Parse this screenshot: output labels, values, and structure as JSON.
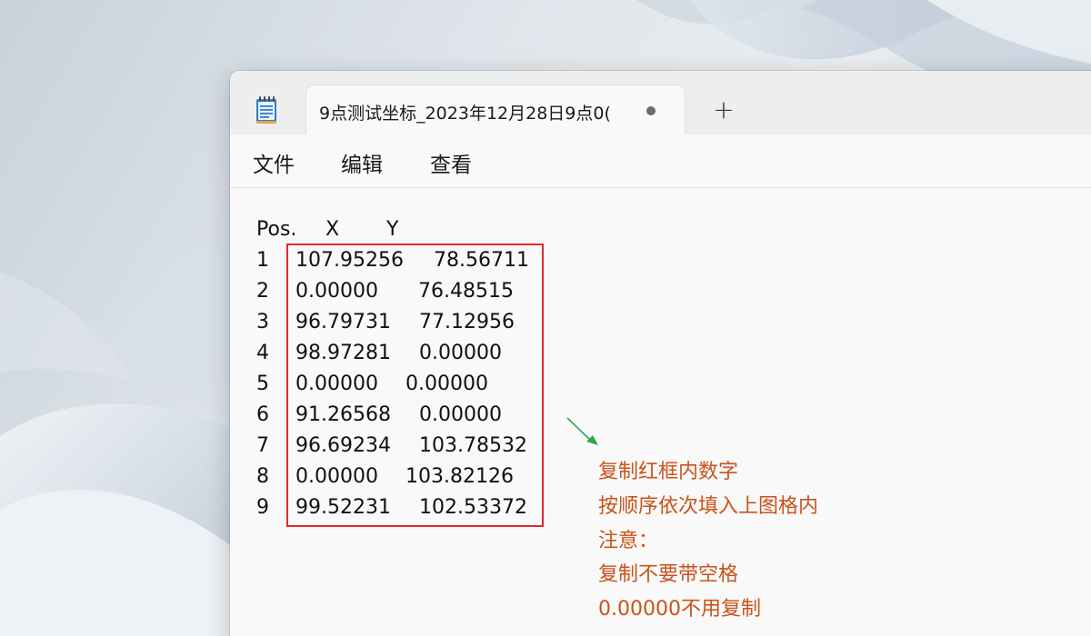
{
  "app": {
    "tab_title": "9点测试坐标_2023年12月28日9点0(",
    "new_tab_symbol": "+",
    "icon": "notepad-icon"
  },
  "menu": [
    "文件",
    "编辑",
    "查看"
  ],
  "table": {
    "header": {
      "pos": "Pos.",
      "x": "X",
      "y": "Y"
    },
    "rows": [
      {
        "pos": "1",
        "x": "107.95256",
        "y": "78.56711"
      },
      {
        "pos": "2",
        "x": "0.00000",
        "y": "76.48515"
      },
      {
        "pos": "3",
        "x": "96.79731",
        "y": "77.12956"
      },
      {
        "pos": "4",
        "x": "98.97281",
        "y": "0.00000"
      },
      {
        "pos": "5",
        "x": "0.00000",
        "y": "0.00000"
      },
      {
        "pos": "6",
        "x": "91.26568",
        "y": "0.00000"
      },
      {
        "pos": "7",
        "x": "96.69234",
        "y": "103.78532"
      },
      {
        "pos": "8",
        "x": "0.00000",
        "y": "103.82126"
      },
      {
        "pos": "9",
        "x": "99.52231",
        "y": "102.53372"
      }
    ]
  },
  "annotation": {
    "lines": [
      "复制红框内数字",
      "按顺序依次填入上图格内",
      "注意：",
      "复制不要带空格",
      "0.00000不用复制"
    ],
    "color": "#c9531a",
    "box_color": "#e02b2b",
    "arrow_color": "#2aa84a"
  }
}
